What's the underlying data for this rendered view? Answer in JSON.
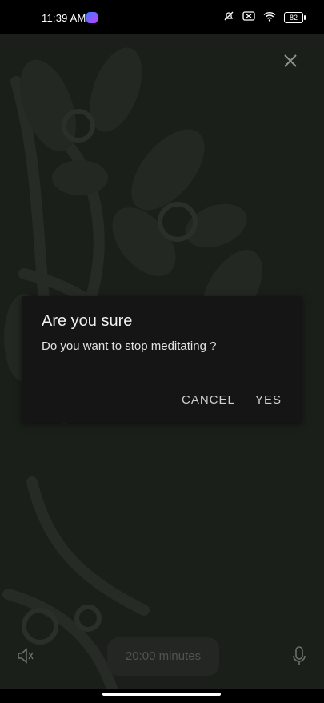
{
  "status_bar": {
    "time": "11:39 AM",
    "battery": "82"
  },
  "dialog": {
    "title": "Are you sure",
    "message": "Do you want to stop meditating ?",
    "cancel_label": "CANCEL",
    "yes_label": "YES"
  },
  "controls": {
    "duration": "20:00 minutes"
  },
  "icons": {
    "close": "close-icon",
    "volume": "volume-icon",
    "mic": "mic-icon",
    "wifi": "wifi-icon",
    "battery": "battery-icon"
  },
  "colors": {
    "background": "#1b1f1a",
    "dialog": "#141514"
  }
}
